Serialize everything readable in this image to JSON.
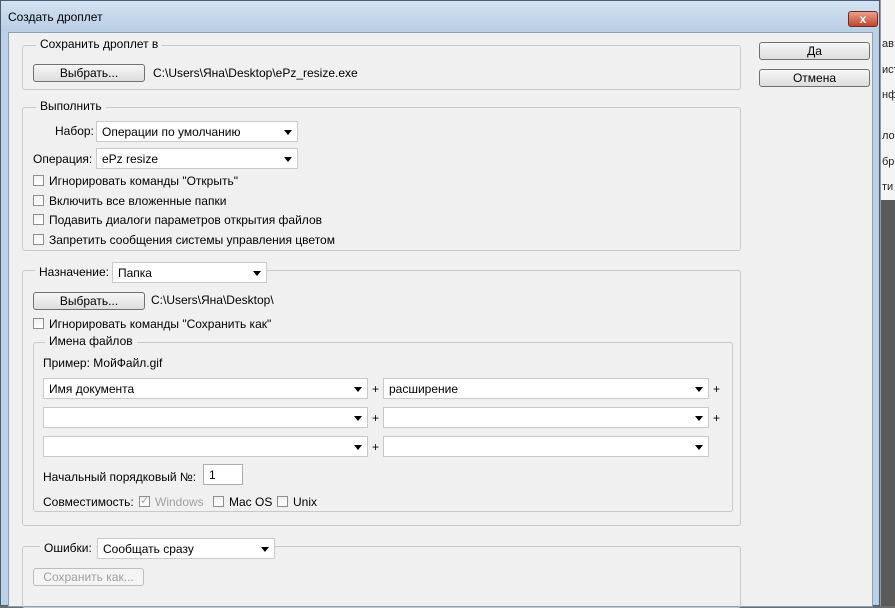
{
  "window": {
    "title": "Создать дроплет",
    "close_glyph": "x"
  },
  "right_buttons": {
    "ok": "Да",
    "cancel": "Отмена"
  },
  "save_droplet": {
    "legend": "Сохранить дроплет в",
    "choose_button": "Выбрать...",
    "path": "C:\\Users\\Яна\\Desktop\\ePz_resize.exe"
  },
  "play": {
    "legend": "Выполнить",
    "set_label": "Набор:",
    "set_value": "Операции по умолчанию",
    "action_label": "Операция:",
    "action_value": "ePz resize",
    "options": [
      {
        "label": "Игнорировать команды \"Открыть\"",
        "checked": false
      },
      {
        "label": "Включить все вложенные папки",
        "checked": false
      },
      {
        "label": "Подавить диалоги параметров открытия файлов",
        "checked": false
      },
      {
        "label": "Запретить сообщения системы управления цветом",
        "checked": false
      }
    ]
  },
  "destination": {
    "label": "Назначение:",
    "value": "Папка",
    "choose_button": "Выбрать...",
    "path": "C:\\Users\\Яна\\Desktop\\",
    "override_save_as": {
      "label": "Игнорировать команды \"Сохранить как\"",
      "checked": false
    },
    "file_naming": {
      "legend": "Имена файлов",
      "example": "Пример: МойФайл.gif",
      "rows": [
        {
          "left": "Имя документа",
          "right": "расширение",
          "trailing_plus": true
        },
        {
          "left": "",
          "right": "",
          "trailing_plus": true
        },
        {
          "left": "",
          "right": "",
          "trailing_plus": false
        }
      ],
      "plus": "+",
      "serial_label": "Начальный порядковый №:",
      "serial_value": "1",
      "compat_label": "Совместимость:",
      "compat": [
        {
          "label": "Windows",
          "checked": true,
          "disabled": true
        },
        {
          "label": "Mac OS",
          "checked": false,
          "disabled": false
        },
        {
          "label": "Unix",
          "checked": false,
          "disabled": false
        }
      ]
    }
  },
  "errors": {
    "label": "Ошибки:",
    "value": "Сообщать сразу",
    "save_as_button": "Сохранить как..."
  },
  "background_fragments": [
    "ав",
    "ист",
    "нф",
    "ло",
    "бр",
    "ти"
  ]
}
